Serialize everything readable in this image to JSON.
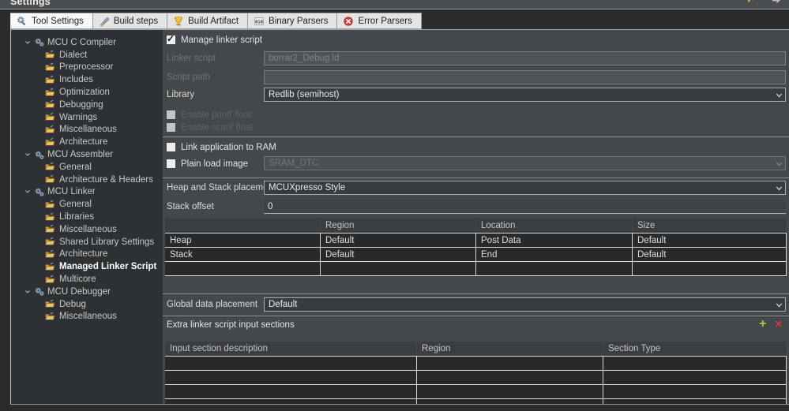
{
  "window": {
    "title": "Settings"
  },
  "tabs": {
    "tool_settings": "Tool Settings",
    "build_steps": "Build steps",
    "build_artifact": "Build Artifact",
    "binary_parsers": "Binary Parsers",
    "error_parsers": "Error Parsers"
  },
  "tree": {
    "compiler": {
      "label": "MCU C Compiler",
      "items": [
        "Dialect",
        "Preprocessor",
        "Includes",
        "Optimization",
        "Debugging",
        "Warnings",
        "Miscellaneous",
        "Architecture"
      ]
    },
    "assembler": {
      "label": "MCU Assembler",
      "items": [
        "General",
        "Architecture & Headers"
      ]
    },
    "linker": {
      "label": "MCU Linker",
      "items": [
        "General",
        "Libraries",
        "Miscellaneous",
        "Shared Library Settings",
        "Architecture",
        "Managed Linker Script",
        "Multicore"
      ],
      "selected_item": "Managed Linker Script"
    },
    "debugger": {
      "label": "MCU Debugger",
      "items": [
        "Debug",
        "Miscellaneous"
      ]
    }
  },
  "form": {
    "manage_linker_script": "Manage linker script",
    "linker_script_label": "Linker script",
    "linker_script_value": "borrar2_Debug.ld",
    "script_path_label": "Script path",
    "script_path_value": "",
    "library_label": "Library",
    "library_value": "Redlib (semihost)",
    "enable_printf": "Enable printf float",
    "enable_scanf": "Enable scanf float",
    "link_to_ram": "Link application to RAM",
    "plain_load_image": "Plain load image",
    "plain_load_value": "SRAM_DTC",
    "heap_stack_label": "Heap and Stack placement",
    "heap_stack_value": "MCUXpresso Style",
    "stack_offset_label": "Stack offset",
    "stack_offset_value": "0",
    "global_data_label": "Global data placement",
    "global_data_value": "Default",
    "extra_sections_label": "Extra linker script input sections"
  },
  "heap_table": {
    "headers": [
      "",
      "Region",
      "Location",
      "Size"
    ],
    "rows": [
      {
        "name": "Heap",
        "region": "Default",
        "location": "Post Data",
        "size": "Default"
      },
      {
        "name": "Stack",
        "region": "Default",
        "location": "End",
        "size": "Default"
      },
      {
        "name": "",
        "region": "",
        "location": "",
        "size": ""
      }
    ]
  },
  "sections_table": {
    "headers": [
      "Input section description",
      "Region",
      "Section Type"
    ],
    "rows": [
      [
        "",
        "",
        ""
      ],
      [
        "",
        "",
        ""
      ],
      [
        "",
        "",
        ""
      ],
      [
        "",
        "",
        ""
      ]
    ]
  },
  "icons": {
    "add": "+",
    "delete": "✕"
  },
  "colors": {
    "accent_add_green": "#9CCB3B",
    "accent_delete_red": "#D4393E",
    "panel_bg": "#45484A",
    "tree_bg": "#2E3133",
    "table_row_bg": "#27292A",
    "titlebar_bg": "#4A4E50",
    "tab_active_bg": "#F8F8F8",
    "error_icon_red": "#CC3B3B",
    "trophy_yellow": "#F0C237"
  }
}
